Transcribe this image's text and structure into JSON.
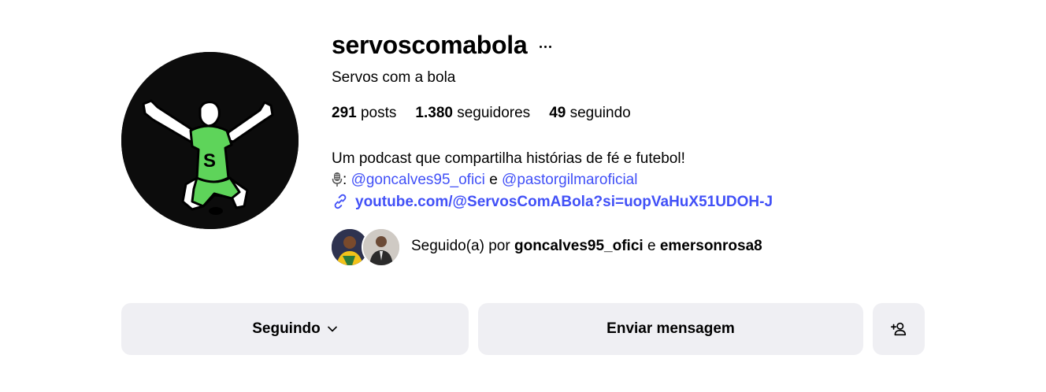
{
  "profile": {
    "username": "servoscomabola",
    "full_name": "Servos com a bola",
    "avatar_icon": "soccer-player-celebrating-logo"
  },
  "stats": {
    "posts_count": "291",
    "posts_label": "posts",
    "followers_count": "1.380",
    "followers_label": "seguidores",
    "following_count": "49",
    "following_label": "seguindo"
  },
  "bio": {
    "line1": "Um podcast que compartilha histórias de fé e futebol!",
    "mic_icon": "microphone-icon",
    "mic_suffix": ":",
    "mention1": "@goncalves95_ofici",
    "connector": "e",
    "mention2": "@pastorgilmaroficial",
    "link_icon": "link-icon",
    "link": "youtube.com/@ServosComABola?si=uopVaHuX51UDOH-J"
  },
  "followed_by": {
    "prefix": "Seguido(a) por",
    "user1": "goncalves95_ofici",
    "connector": "e",
    "user2": "emersonrosa8"
  },
  "actions": {
    "following_label": "Seguindo",
    "message_label": "Enviar mensagem",
    "add_user_icon": "add-user-icon"
  },
  "colors": {
    "link": "#4150f7",
    "button_bg": "#efeff3",
    "avatar_green": "#5ed45a"
  }
}
